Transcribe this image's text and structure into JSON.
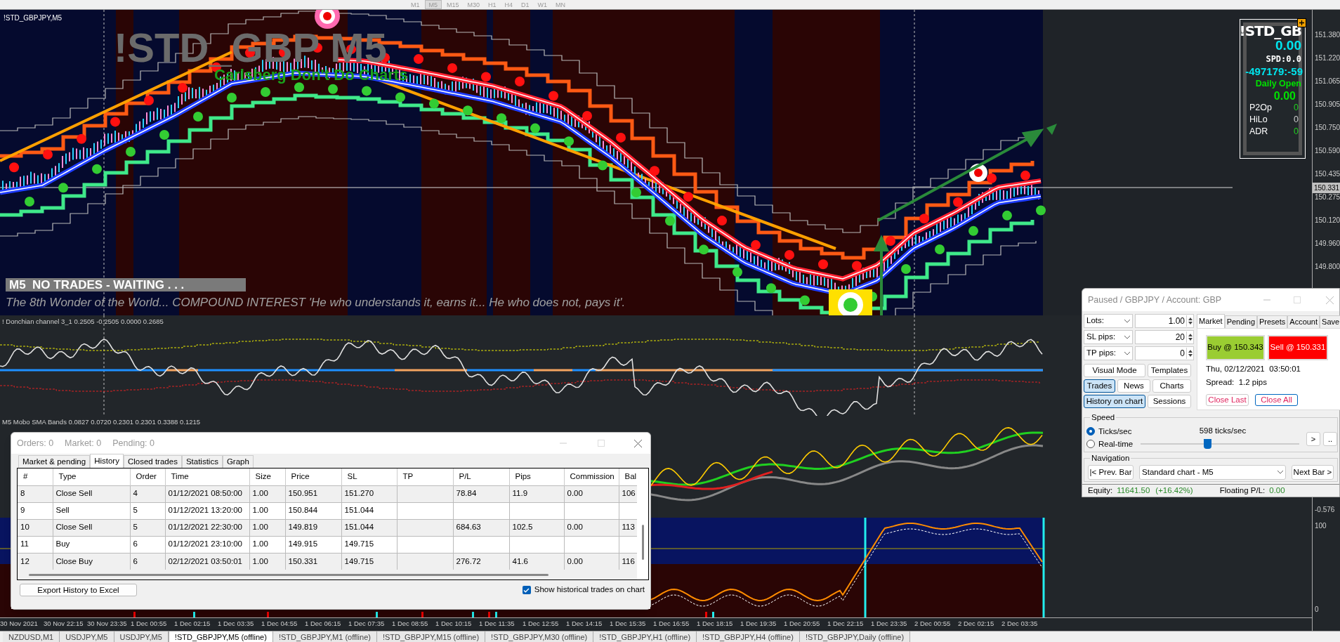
{
  "toolbar": {
    "timeframes": [
      {
        "label": "M1",
        "selected": false
      },
      {
        "label": "M5",
        "selected": true
      },
      {
        "label": "M15",
        "selected": false
      },
      {
        "label": "M30",
        "selected": false
      },
      {
        "label": "H1",
        "selected": false
      },
      {
        "label": "H4",
        "selected": false
      },
      {
        "label": "D1",
        "selected": false
      },
      {
        "label": "W1",
        "selected": false
      },
      {
        "label": "MN",
        "selected": false
      }
    ]
  },
  "chart": {
    "symbol_label": "!STD_GBPJPY,M5",
    "title": "!STD_GBP M5",
    "subtitle": "Carlsberg Don't Do Charts",
    "status": "M5  NO TRADES - WAITING . . .",
    "quote": "The 8th Wonder of the World... COMPOUND INTEREST  'He who understands it, earns it... He who does not, pays it'.",
    "price_axis": [
      "151.380",
      "151.220",
      "151.065",
      "150.905",
      "150.750",
      "150.590",
      "150.435",
      "150.275",
      "150.120",
      "149.960",
      "149.800"
    ],
    "current_price": "150.331"
  },
  "info_panel": {
    "symbol": "!STD_GB",
    "value": "0.00",
    "spread": "SPD:0.0",
    "counter": "-497179:-59",
    "daily_open_label": "Daily Open",
    "daily_open": "0.00",
    "stats": [
      {
        "label": "P2Op",
        "value": "0",
        "color": "#22cc22"
      },
      {
        "label": "HiLo",
        "value": "0",
        "color": "#cccccc"
      },
      {
        "label": "ADR",
        "value": "0",
        "color": "#22cc22"
      }
    ]
  },
  "indicators": [
    {
      "label": "! Donchian channel 3_1 0.2505 -0.2505 0.0000 0.2685"
    },
    {
      "label": "M5 Mobo SMA Bands 0.0827 0.0720 0.2301 0.2301 0.3388 0.1215",
      "axis": [
        "-0.576"
      ]
    },
    {
      "axis": [
        "100",
        "0"
      ]
    }
  ],
  "time_axis": [
    "30 Nov 2021",
    "30 Nov 22:15",
    "30 Nov 23:35",
    "1 Dec 00:55",
    "1 Dec 02:15",
    "1 Dec 03:35",
    "1 Dec 04:55",
    "1 Dec 06:15",
    "1 Dec 07:35",
    "1 Dec 08:55",
    "1 Dec 10:15",
    "1 Dec 11:35",
    "1 Dec 12:55",
    "1 Dec 14:15",
    "1 Dec 15:35",
    "1 Dec 16:55",
    "1 Dec 18:15",
    "1 Dec 19:35",
    "1 Dec 20:55",
    "1 Dec 22:15",
    "1 Dec 23:35",
    "2 Dec 00:55",
    "2 Dec 02:15",
    "2 Dec 03:35"
  ],
  "history_window": {
    "counts": [
      "Orders: 0",
      "Market: 0",
      "Pending: 0"
    ],
    "tabs": [
      {
        "label": "Market & pending",
        "selected": false
      },
      {
        "label": "History",
        "selected": true
      },
      {
        "label": "Closed trades",
        "selected": false
      },
      {
        "label": "Statistics",
        "selected": false
      },
      {
        "label": "Graph",
        "selected": false
      }
    ],
    "columns": [
      "#",
      "Type",
      "Order",
      "Time",
      "Size",
      "Price",
      "SL",
      "TP",
      "P/L",
      "Pips",
      "Commission",
      "Bal"
    ],
    "rows": [
      [
        "8",
        "Close Sell",
        "4",
        "01/12/2021 08:50:00",
        "1.00",
        "150.951",
        "151.270",
        "",
        "78.84",
        "11.9",
        "0.00",
        "106"
      ],
      [
        "9",
        "Sell",
        "5",
        "01/12/2021 13:20:00",
        "1.00",
        "150.844",
        "151.044",
        "",
        "",
        "",
        "",
        ""
      ],
      [
        "10",
        "Close Sell",
        "5",
        "01/12/2021 22:30:00",
        "1.00",
        "149.819",
        "151.044",
        "",
        "684.63",
        "102.5",
        "0.00",
        "113"
      ],
      [
        "11",
        "Buy",
        "6",
        "01/12/2021 23:10:00",
        "1.00",
        "149.915",
        "149.715",
        "",
        "",
        "",
        "",
        ""
      ],
      [
        "12",
        "Close Buy",
        "6",
        "02/12/2021 03:50:01",
        "1.00",
        "150.331",
        "149.715",
        "",
        "276.72",
        "41.6",
        "0.00",
        "116"
      ]
    ],
    "export_button": "Export History to Excel",
    "show_trades": {
      "label": "Show historical trades on chart",
      "checked": true
    }
  },
  "trade_panel": {
    "title": "Paused / GBPJPY / Account: GBP",
    "fields": [
      {
        "label": "Lots:",
        "value": "1.00"
      },
      {
        "label": "SL pips:",
        "value": "20"
      },
      {
        "label": "TP pips:",
        "value": "0"
      }
    ],
    "buttons": [
      {
        "label": "Visual Mode",
        "selected": false
      },
      {
        "label": "Templates",
        "selected": false
      },
      {
        "label": "Trades",
        "selected": true
      },
      {
        "label": "News",
        "selected": false
      },
      {
        "label": "Charts",
        "selected": false
      },
      {
        "label": "History on chart",
        "selected": true
      },
      {
        "label": "Sessions",
        "selected": false
      }
    ],
    "tabs": [
      {
        "label": "Market",
        "selected": true
      },
      {
        "label": "Pending",
        "selected": false
      },
      {
        "label": "Presets",
        "selected": false
      },
      {
        "label": "Account",
        "selected": false
      },
      {
        "label": "Save",
        "selected": false
      }
    ],
    "buy": "Buy @ 150.343",
    "sell": "Sell @ 150.331",
    "datetime": "Thu, 02/12/2021  03:50:01",
    "spread": "Spread:  1.2 pips",
    "close_last": "Close Last",
    "close_all": "Close All",
    "speed": {
      "title": "Speed",
      "options": [
        {
          "label": "Ticks/sec",
          "selected": true
        },
        {
          "label": "Real-time",
          "selected": false
        }
      ],
      "reading": "598 ticks/sec",
      "level": 0.42,
      "buttons": [
        ">",
        ".."
      ]
    },
    "navigation": {
      "title": "Navigation",
      "prev": "|< Prev. Bar",
      "select": "Standard chart - M5",
      "next": "Next Bar >"
    },
    "status": {
      "equity_label": "Equity:",
      "equity": "11641.50",
      "change": "(+16.42%)",
      "floating_label": "Floating P/L:",
      "floating": "0.00"
    }
  },
  "chart_tabs": [
    {
      "label": "NZDUSD,M1",
      "selected": false
    },
    {
      "label": "USDJPY,M5",
      "selected": false
    },
    {
      "label": "USDJPY,M5",
      "selected": false
    },
    {
      "label": "!STD_GBPJPY,M5 (offline)",
      "selected": true
    },
    {
      "label": "!STD_GBPJPY,M1 (offline)",
      "selected": false
    },
    {
      "label": "!STD_GBPJPY,M15 (offline)",
      "selected": false
    },
    {
      "label": "!STD_GBPJPY,M30 (offline)",
      "selected": false
    },
    {
      "label": "!STD_GBPJPY,H1 (offline)",
      "selected": false
    },
    {
      "label": "!STD_GBPJPY,H4 (offline)",
      "selected": false
    },
    {
      "label": "!STD_GBPJPY,Daily (offline)",
      "selected": false
    }
  ]
}
